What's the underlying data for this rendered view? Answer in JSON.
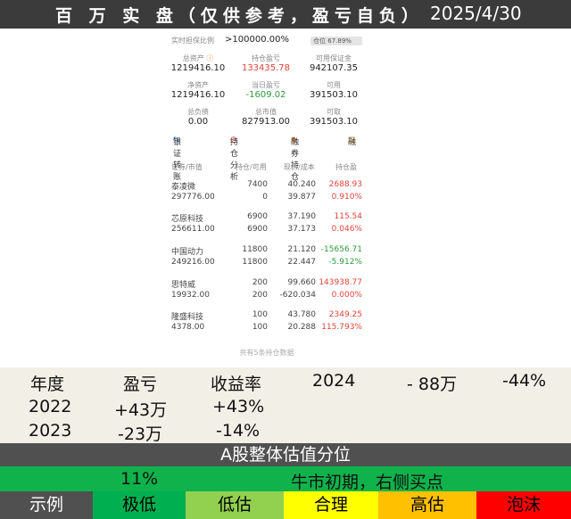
{
  "header": {
    "title": "百 万 实 盘（仅供参考，盈亏自负）",
    "date": "2025/4/30"
  },
  "phone": {
    "ratio_label": "实时担保比例",
    "ratio_value": ">100000.00%",
    "gauge_label": "仓位",
    "gauge_value": "67.89%",
    "stats": [
      {
        "label": "总资产",
        "value": "1219416.10",
        "icon": "info-icon"
      },
      {
        "label": "持仓盈亏",
        "value": "133435.78",
        "color": "red"
      },
      {
        "label": "可用保证金",
        "value": "942107.35"
      },
      {
        "label": "净资产",
        "value": "1219416.10"
      },
      {
        "label": "当日盈亏",
        "value": "-1609.02",
        "color": "green"
      },
      {
        "label": "可用",
        "value": "391503.10"
      },
      {
        "label": "总负债",
        "value": "0.00"
      },
      {
        "label": "总市值",
        "value": "827913.00"
      },
      {
        "label": "可取",
        "value": "391503.10"
      }
    ],
    "tools": [
      "银证转账",
      "持仓分析",
      "融券持仓",
      "融"
    ],
    "columns": [
      "证券/市值",
      "持仓/可用",
      "现价/成本",
      "持仓盈"
    ],
    "sort_marker": "市值",
    "stocks": [
      {
        "name": "泰凌微",
        "mv": "297776.00",
        "hold": "7400",
        "avail": "0",
        "price": "40.240",
        "cost": "39.877",
        "pl": "2688.93",
        "pct": "0.910%",
        "pl_color": "red",
        "pct_color": "red"
      },
      {
        "name": "芯原科技",
        "mv": "256611.00",
        "hold": "6900",
        "avail": "6900",
        "price": "37.190",
        "cost": "37.173",
        "pl": "115.54",
        "pct": "0.046%",
        "pl_color": "red",
        "pct_color": "red"
      },
      {
        "name": "中国动力",
        "mv": "249216.00",
        "hold": "11800",
        "avail": "11800",
        "price": "21.120",
        "cost": "22.447",
        "pl": "-15656.71",
        "pct": "-5.912%",
        "pl_color": "green",
        "pct_color": "green"
      },
      {
        "name": "思特威",
        "mv": "19932.00",
        "hold": "200",
        "avail": "200",
        "price": "99.660",
        "cost": "-620.034",
        "pl": "143938.77",
        "pct": "0.000%",
        "pl_color": "red",
        "pct_color": "red"
      },
      {
        "name": "隆盛科技",
        "mv": "4378.00",
        "hold": "100",
        "avail": "100",
        "price": "43.780",
        "cost": "20.288",
        "pl": "2349.25",
        "pct": "115.793%",
        "pl_color": "red",
        "pct_color": "red"
      }
    ],
    "footer": "共有5条持仓数据"
  },
  "performance": {
    "headers": [
      "年度",
      "盈亏",
      "收益率"
    ],
    "rows": [
      {
        "year": "2024",
        "pl": "- 88万",
        "rate": "-44%"
      },
      {
        "year": "2022",
        "pl": "+43万",
        "rate": "+43%"
      },
      {
        "year": "2023",
        "pl": "-23万",
        "rate": "-14%"
      }
    ]
  },
  "valuation": {
    "title": "A股整体估值分位",
    "percent": "11%",
    "comment": "牛市初期，右侧买点"
  },
  "legend": {
    "label": "示例",
    "items": [
      {
        "text": "极低",
        "color": "#00b050"
      },
      {
        "text": "低估",
        "color": "#92d050"
      },
      {
        "text": "合理",
        "color": "#ffff00"
      },
      {
        "text": "高估",
        "color": "#ffc000"
      },
      {
        "text": "泡沫",
        "color": "#ff0000"
      }
    ]
  }
}
